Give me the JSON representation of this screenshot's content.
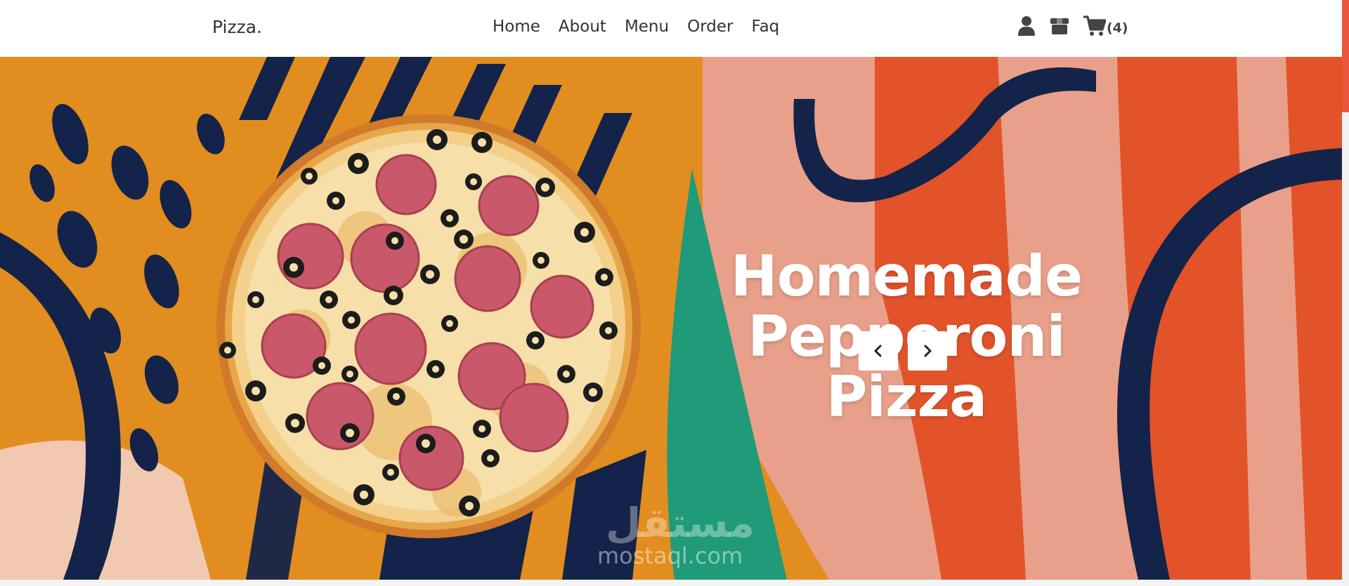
{
  "header": {
    "brand": "Pizza.",
    "nav": [
      "Home",
      "About",
      "Menu",
      "Order",
      "Faq"
    ],
    "icons": [
      "user-icon",
      "box-icon",
      "cart-icon"
    ],
    "cart_count": "(4)"
  },
  "hero": {
    "headline_line1": "Homemade",
    "headline_line2": "Pepperoni Pizza",
    "prev_icon": "chevron-left-icon",
    "next_icon": "chevron-right-icon"
  },
  "watermark": {
    "arabic": "مستقل",
    "latin": "mostaql.com"
  },
  "colors": {
    "accent": "#e8563f",
    "orange": "#e28d1f",
    "navy": "#142349",
    "teal": "#1f9b7a",
    "pink": "#e9a08a",
    "red_orange": "#e2532a"
  }
}
